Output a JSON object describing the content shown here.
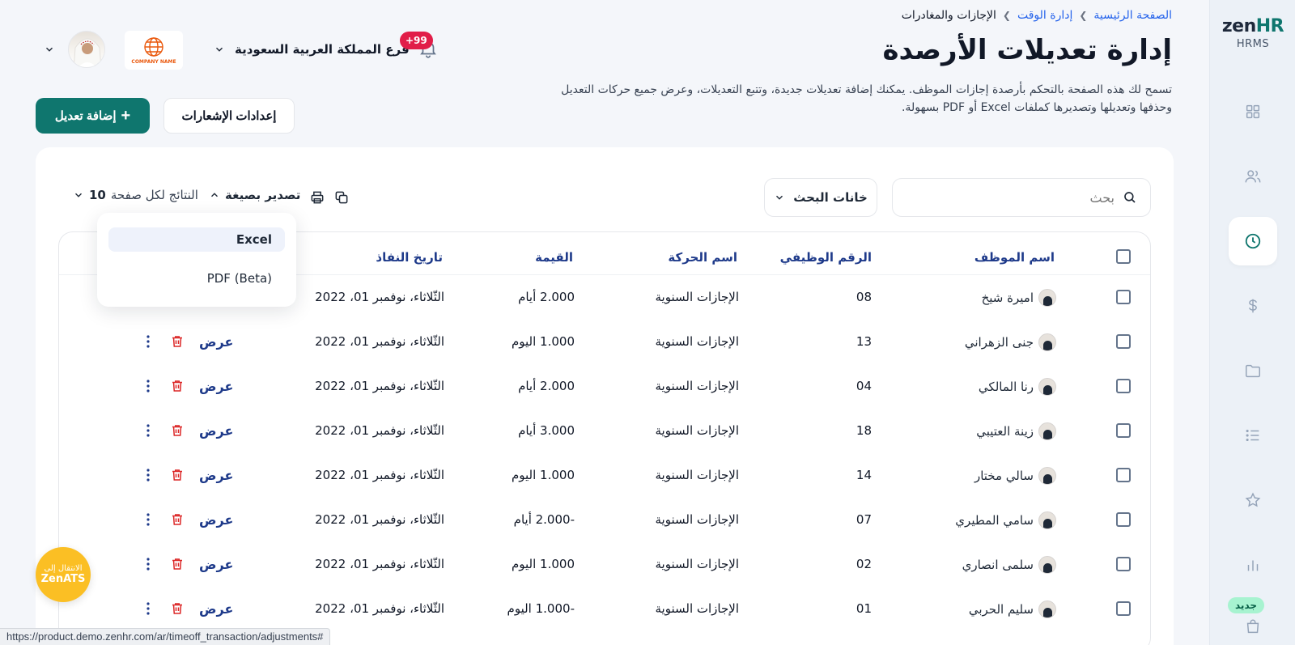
{
  "sidebar": {
    "brand_prefix": "zen",
    "brand_suffix": "HR",
    "subtitle": "HRMS",
    "new_badge": "جديد",
    "accent": "#0f766e"
  },
  "header": {
    "breadcrumb": [
      "الصفحة الرئيسية",
      "إدارة الوقت",
      "الإجازات والمغادرات"
    ],
    "title": "إدارة تعديلات الأرصدة",
    "description": "تسمح لك هذه الصفحة بالتحكم بأرصدة إجازات الموظف. يمكنك إضافة تعديلات جديدة، وتتبع التعديلات، وعرض جميع حركات التعديل وحذفها وتعديلها وتصديرها كملفات Excel أو PDF بسهولة.",
    "branch": "فرع المملكة العربية السعودية",
    "notifications": "+99",
    "company_name": "COMPANY NAME"
  },
  "actions": {
    "add_adjustment": "إضافة تعديل",
    "notification_settings": "إعدادات الإشعارات"
  },
  "toolbar": {
    "search_placeholder": "بحث",
    "search_fields": "خانات البحث",
    "export_label": "تصدير بصيغة",
    "per_page_label": "النتائج لكل صفحة",
    "per_page_value": "10"
  },
  "export_menu": {
    "options": [
      "Excel",
      "PDF (Beta)"
    ],
    "selected": "Excel"
  },
  "table": {
    "headers": {
      "employee": "اسم الموظف",
      "employee_id": "الرقم الوظيفي",
      "transaction": "اسم الحركة",
      "value": "القيمة",
      "effective_date": "تاريخ النفاذ"
    },
    "view_label": "عرض",
    "rows": [
      {
        "name": "اميرة شيخ",
        "id": "08",
        "transaction": "الإجازات السنوية",
        "value": "2.000 أيام",
        "date": "الثّلاثاء، نوفمبر 01، 2022"
      },
      {
        "name": "جنى الزهراني",
        "id": "13",
        "transaction": "الإجازات السنوية",
        "value": "1.000 اليوم",
        "date": "الثّلاثاء، نوفمبر 01، 2022"
      },
      {
        "name": "رنا المالكي",
        "id": "04",
        "transaction": "الإجازات السنوية",
        "value": "2.000 أيام",
        "date": "الثّلاثاء، نوفمبر 01، 2022"
      },
      {
        "name": "زينة العتيبي",
        "id": "18",
        "transaction": "الإجازات السنوية",
        "value": "3.000 أيام",
        "date": "الثّلاثاء، نوفمبر 01، 2022"
      },
      {
        "name": "سالي مختار",
        "id": "14",
        "transaction": "الإجازات السنوية",
        "value": "1.000 اليوم",
        "date": "الثّلاثاء، نوفمبر 01، 2022"
      },
      {
        "name": "سامي المطيري",
        "id": "07",
        "transaction": "الإجازات السنوية",
        "value": "-2.000 أيام",
        "date": "الثّلاثاء، نوفمبر 01، 2022"
      },
      {
        "name": "سلمى انصاري",
        "id": "02",
        "transaction": "الإجازات السنوية",
        "value": "1.000 اليوم",
        "date": "الثّلاثاء، نوفمبر 01، 2022"
      },
      {
        "name": "سليم الحربي",
        "id": "01",
        "transaction": "الإجازات السنوية",
        "value": "-1.000 اليوم",
        "date": "الثّلاثاء، نوفمبر 01، 2022"
      }
    ]
  },
  "zenats": {
    "line1": "الانتقال إلى",
    "line2": "ZenATS"
  },
  "status_url": "https://product.demo.zenhr.com/ar/timeoff_transaction/adjustments#"
}
